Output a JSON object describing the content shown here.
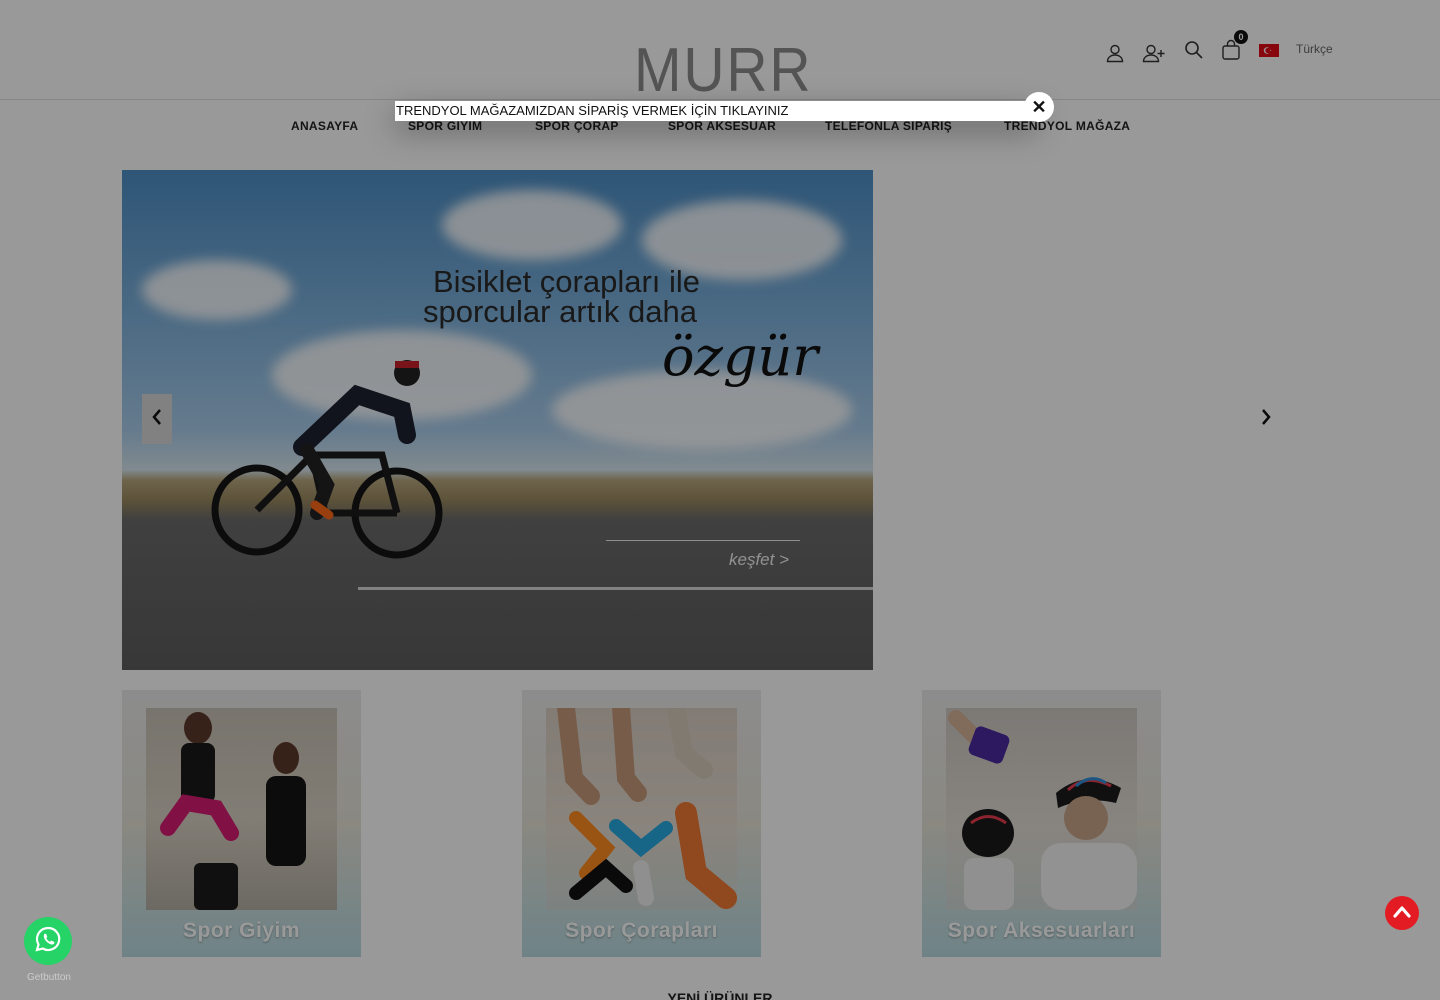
{
  "header": {
    "logo_text": "MURR",
    "cart_count": "0",
    "language": "Türkçe"
  },
  "nav": {
    "items": [
      {
        "label": "ANASAYFA"
      },
      {
        "label": "SPOR GİYİM"
      },
      {
        "label": "SPOR ÇORAP"
      },
      {
        "label": "SPOR AKSESUAR"
      },
      {
        "label": "TELEFONLA SİPARİŞ"
      },
      {
        "label": "TRENDYOL MAĞAZA"
      }
    ]
  },
  "hero": {
    "line1": "Bisiklet çorapları ile",
    "line2": "sporcular artık daha",
    "script": "özgür",
    "cta": "keşfet >"
  },
  "categories": [
    {
      "label": "Spor Giyim"
    },
    {
      "label": "Spor Çorapları"
    },
    {
      "label": "Spor Aksesuarları"
    }
  ],
  "section": {
    "title": "YENİ ÜRÜNLER"
  },
  "popup": {
    "text": "TRENDYOL MAĞAZAMIZDAN SİPARİŞ VERMEK İÇİN TIKLAYINIZ",
    "close": "✕"
  },
  "whatsapp": {
    "label": "Getbutton"
  },
  "colors": {
    "whatsapp": "#25d366",
    "scroll_top": "#e31b23",
    "flag": "#e30a17"
  },
  "icons": [
    "user-icon",
    "user-add-icon",
    "search-icon",
    "shopping-bag-icon",
    "turkey-flag-icon",
    "whatsapp-icon",
    "scroll-top-icon",
    "chevron-left-icon",
    "chevron-right-icon",
    "close-icon"
  ]
}
